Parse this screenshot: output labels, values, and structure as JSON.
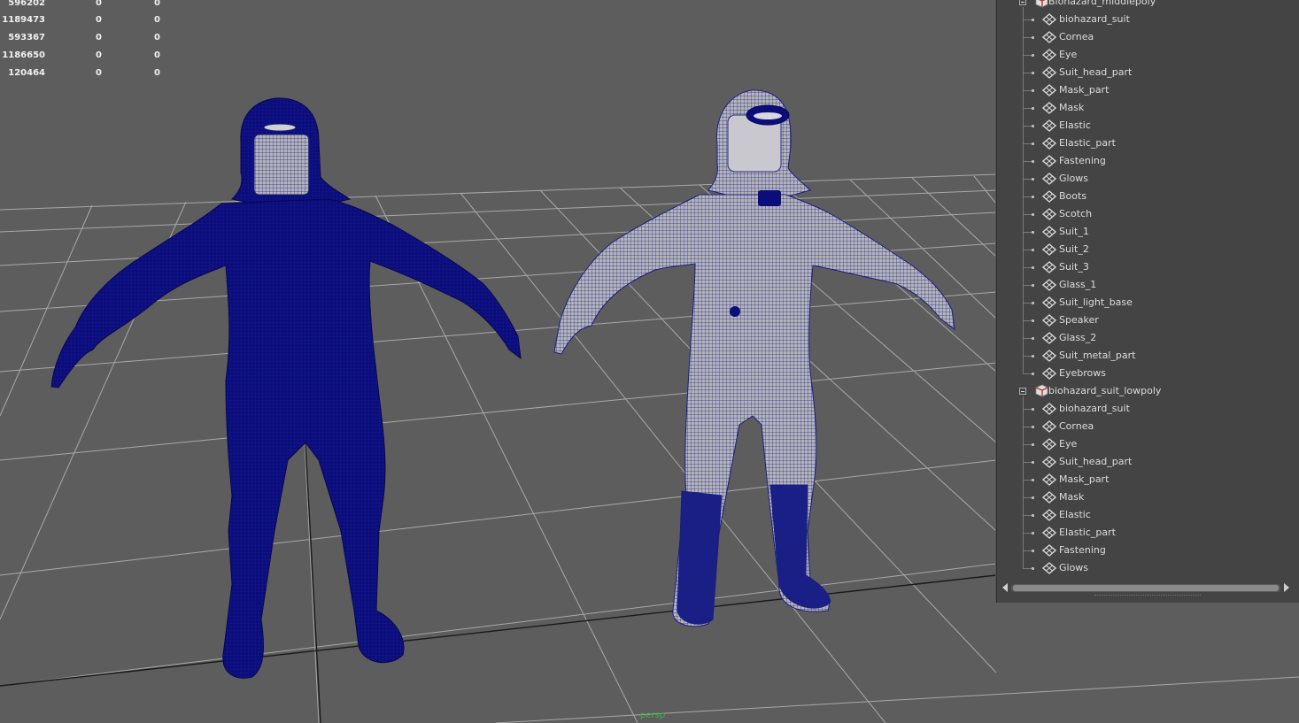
{
  "hud": {
    "rows": [
      {
        "a": "596202",
        "b": "0",
        "c": "0"
      },
      {
        "a": "1189473",
        "b": "0",
        "c": "0"
      },
      {
        "a": "593367",
        "b": "0",
        "c": "0"
      },
      {
        "a": "1186650",
        "b": "0",
        "c": "0"
      },
      {
        "a": "120464",
        "b": "0",
        "c": "0"
      }
    ]
  },
  "viewport": {
    "camera_label": "persp",
    "camera_label_color": "#3bb043",
    "background_color": "#5d5d5d",
    "grid_color": "#a8a8a8",
    "wire_color": "#0b0d7a",
    "shaded_color": "#b3b3b3"
  },
  "outliner": {
    "groups": [
      {
        "name": "Biohazard_middlepoly",
        "expanded": true,
        "children": [
          "biohazard_suit",
          "Cornea",
          "Eye",
          "Suit_head_part",
          "Mask_part",
          "Mask",
          "Elastic",
          "Elastic_part",
          "Fastening",
          "Glows",
          "Boots",
          "Scotch",
          "Suit_1",
          "Suit_2",
          "Suit_3",
          "Glass_1",
          "Suit_light_base",
          "Speaker",
          "Glass_2",
          "Suit_metal_part",
          "Eyebrows"
        ]
      },
      {
        "name": "biohazard_suit_lowpoly",
        "expanded": true,
        "children": [
          "biohazard_suit",
          "Cornea",
          "Eye",
          "Suit_head_part",
          "Mask_part",
          "Mask",
          "Elastic",
          "Elastic_part",
          "Fastening",
          "Glows"
        ]
      }
    ]
  }
}
